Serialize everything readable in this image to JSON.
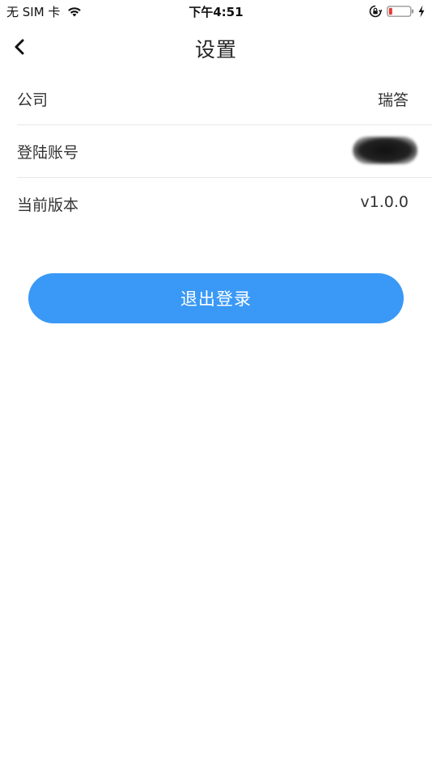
{
  "status_bar": {
    "carrier": "无 SIM 卡",
    "time": "下午4:51",
    "icons": [
      "wifi-icon",
      "rotation-lock-icon",
      "battery-icon",
      "charging-bolt-icon"
    ],
    "battery_color": "#e53935"
  },
  "nav": {
    "title": "设置",
    "back_icon": "chevron-left-icon"
  },
  "settings": {
    "rows": [
      {
        "label": "公司",
        "value": "瑞答"
      },
      {
        "label": "登陆账号",
        "value": ""
      },
      {
        "label": "当前版本",
        "value": "v1.0.0"
      }
    ]
  },
  "logout": {
    "label": "退出登录",
    "color": "#3a99f6"
  }
}
